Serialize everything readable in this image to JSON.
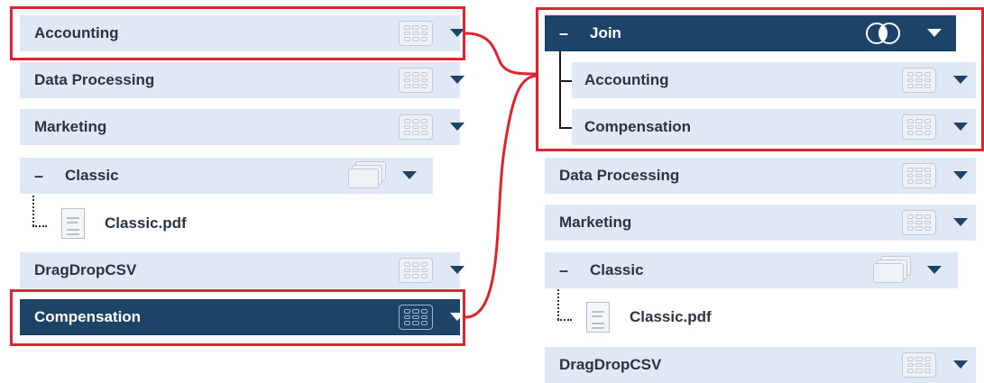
{
  "left_panel": {
    "items": [
      {
        "label": "Accounting"
      },
      {
        "label": "Data Processing"
      },
      {
        "label": "Marketing"
      },
      {
        "label": "Classic"
      },
      {
        "label": "Classic.pdf"
      },
      {
        "label": "DragDropCSV"
      },
      {
        "label": "Compensation"
      }
    ],
    "collapse_symbol": "–"
  },
  "right_panel": {
    "join": {
      "label": "Join",
      "collapse_symbol": "–",
      "children": [
        {
          "label": "Accounting"
        },
        {
          "label": "Compensation"
        }
      ]
    },
    "items": [
      {
        "label": "Data Processing"
      },
      {
        "label": "Marketing"
      },
      {
        "label": "Classic"
      },
      {
        "label": "Classic.pdf"
      },
      {
        "label": "DragDropCSV"
      }
    ],
    "collapse_symbol": "–"
  },
  "icons": {
    "table": "table-grid-icon",
    "stacked_tables": "stacked-tables-icon",
    "dropdown": "chevron-down-icon",
    "join": "venn-join-icon",
    "pdf": "pdf-file-icon"
  },
  "colors": {
    "row_bg": "#e1e8f5",
    "selected_bg": "#1d4467",
    "highlight": "#e0242d",
    "text": "#2a3542"
  }
}
